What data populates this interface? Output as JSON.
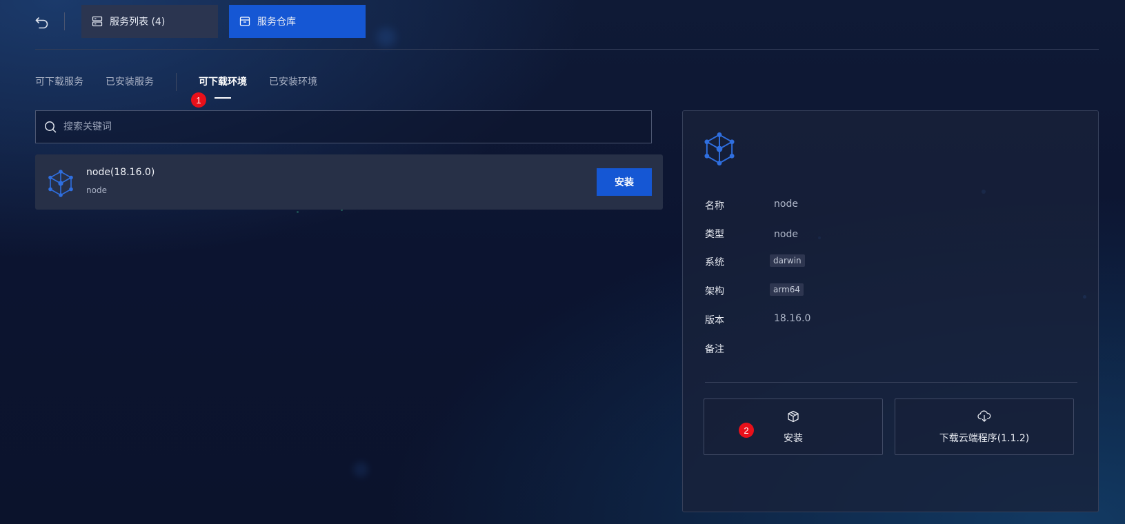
{
  "topbar": {
    "tabs": [
      {
        "label": "服务列表 (4)",
        "icon": "server-list-icon"
      },
      {
        "label": "服务仓库",
        "icon": "box-icon"
      }
    ]
  },
  "subtabs": {
    "items": [
      {
        "label": "可下载服务"
      },
      {
        "label": "已安装服务"
      },
      {
        "label": "可下载环境",
        "active": true
      },
      {
        "label": "已安装环境"
      }
    ]
  },
  "badges": {
    "first": "1",
    "second": "2"
  },
  "search": {
    "placeholder": "搜索关键词"
  },
  "list": {
    "items": [
      {
        "title": "node(18.16.0)",
        "subtitle": "node",
        "action": "安装"
      }
    ]
  },
  "detail": {
    "fields": {
      "name": {
        "label": "名称",
        "value": "node"
      },
      "type": {
        "label": "类型",
        "value": "node"
      },
      "system": {
        "label": "系统",
        "value": "darwin"
      },
      "arch": {
        "label": "架构",
        "value": "arm64"
      },
      "version": {
        "label": "版本",
        "value": "18.16.0"
      },
      "note": {
        "label": "备注",
        "value": ""
      }
    },
    "actions": {
      "install": {
        "label": "安装",
        "icon": "cube-icon"
      },
      "download": {
        "label": "下载云端程序(1.1.2)",
        "icon": "cloud-download-icon"
      }
    }
  },
  "colors": {
    "accent": "#1557d4",
    "badge": "#e8101a",
    "background": "#0c1430"
  }
}
